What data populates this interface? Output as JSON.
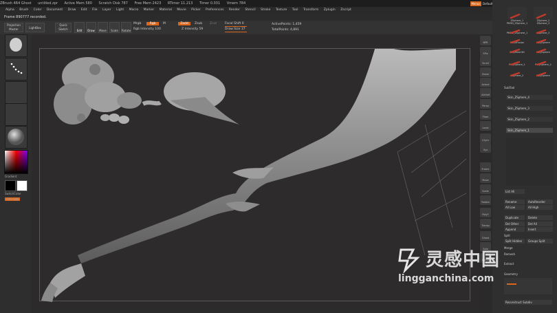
{
  "titlebar": {
    "items": [
      "ZBrush 4R4 Ghost",
      "untitled.zpr",
      "Active Mem 580",
      "Scratch Disk 787",
      "Free Mem 2423",
      "RTimer 11.213",
      "Timer 0.031",
      "Vmem 784"
    ]
  },
  "menu": [
    "Alpha",
    "Brush",
    "Color",
    "Document",
    "Draw",
    "Edit",
    "File",
    "Layer",
    "Light",
    "Macro",
    "Marker",
    "Material",
    "Movie",
    "Picker",
    "Preferences",
    "Render",
    "Stencil",
    "Stroke",
    "Texture",
    "Tool",
    "Transform",
    "Zplugin",
    "Zscript"
  ],
  "topright": {
    "menus_label": "Menus",
    "script_label": "DefaultZScript"
  },
  "notification": "Frame 890777 recorded.",
  "toolbar": {
    "projection_master": "Projection Master",
    "lightbox": "LightBox",
    "quick_sketch": "Quick Sketch",
    "edit": "Edit",
    "draw": "Draw",
    "move": "Move",
    "scale": "Scale",
    "rotate": "Rotate",
    "mrgb": "Mrgb",
    "rgb": "Rgb",
    "m": "M",
    "rgb_intensity": "Rgb Intensity 100",
    "zadd": "Zadd",
    "zsub": "Zsub",
    "zcut": "Zcut",
    "z_intensity": "Z Intensity 59",
    "focal_shift": "Focal Shift 0",
    "draw_size": "Draw Size 37",
    "active_points": "ActivePoints: 1,459",
    "total_points": "TotalPoints: 4,891"
  },
  "leftshelf": {
    "gradient": "Gradient",
    "switch_color": "SwitchColor",
    "alternate": "Alternate"
  },
  "rightshelf": [
    "BPR",
    "SPix",
    "Scroll",
    "Zoom",
    "Actual",
    "AAHalf",
    "Persp",
    "Floor",
    "Local",
    "LSym",
    "Xyz",
    "Frame",
    "Move",
    "Scale",
    "Rotate",
    "PolyF",
    "Transp",
    "Ghost",
    "Solo",
    "Xpose"
  ],
  "toolpanel": {
    "thumbs": [
      "ZSphere_1",
      "ZSphere_2",
      "PM3D_ZSphere_1",
      "ZSphere_3",
      "PM3D_ZSphere_1",
      "ZSphere_3",
      "MeshFusion",
      "PolySphere",
      "PolyMesh3D",
      "PolySphere",
      "PolySphere_1",
      "PolySphere_2",
      "ZSphere_2",
      "PolySphere"
    ],
    "subtool_label": "SubTool",
    "subtools": [
      "Skin_ZSphere_4",
      "Skin_ZSphere_3",
      "Skin_ZSphere_2",
      "Skin_ZSphere_1"
    ],
    "subtool_buttons": {
      "list_all": "List All",
      "rename": "Rename",
      "autoreorder": "AutoReorder",
      "all_low": "All Low",
      "all_high": "All High",
      "duplicate": "Duplicate",
      "delete": "Delete",
      "del_other": "Del Other",
      "del_all": "Del All",
      "append": "Append",
      "insert": "Insert",
      "split": "Split",
      "split_hidden": "Split Hidden",
      "groups_split": "Groups Split",
      "merge": "Merge",
      "remesh": "Remesh",
      "extract": "Extract",
      "geometry": "Geometry",
      "reconstruct_subdiv": "Reconstruct Subdiv"
    }
  },
  "watermark": {
    "brand": "灵感中国",
    "url": "lingganchina.com"
  },
  "colors": {
    "accent": "#d9671e",
    "background": "#2b2b2b",
    "mesh": "#a9a9a9"
  }
}
